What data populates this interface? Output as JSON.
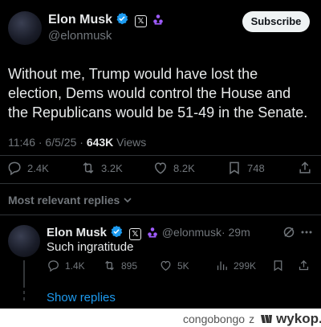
{
  "main_tweet": {
    "name": "Elon Musk",
    "handle": "@elonmusk",
    "x_badge": "𝕏",
    "subscribe_label": "Subscribe",
    "text": "Without me, Trump would have lost the election, Dems would control the House and the Republicans would be 51-49 in the Senate.",
    "timestamp": "11:46 · 6/5/25 · ",
    "views_count": "643K",
    "views_label": " Views",
    "actions": {
      "replies": "2.4K",
      "reposts": "3.2K",
      "likes": "8.2K",
      "bookmarks": "748"
    }
  },
  "sort_label": "Most relevant replies",
  "reply": {
    "name": "Elon Musk",
    "handle": "@elonmusk",
    "time": "· 29m",
    "x_badge": "𝕏",
    "text": "Such ingratitude",
    "actions": {
      "replies": "1.4K",
      "reposts": "895",
      "likes": "5K",
      "views": "299K"
    },
    "show_replies_label": "Show replies"
  },
  "footer": {
    "username": "congobongo",
    "separator": "z",
    "site": "wykop.pl"
  },
  "colors": {
    "background": "#000000",
    "text": "#e7e9ea",
    "muted": "#71767b",
    "verified": "#1d9bf0",
    "link": "#1d9bf0",
    "affiliate": "#a05cff"
  },
  "icons": [
    "verified-badge-icon",
    "x-badge-icon",
    "affiliate-icon",
    "reply-icon",
    "repost-icon",
    "like-icon",
    "bookmark-icon",
    "share-icon",
    "chevron-down-icon",
    "grok-icon",
    "more-icon",
    "views-icon",
    "wykop-logo-icon"
  ]
}
